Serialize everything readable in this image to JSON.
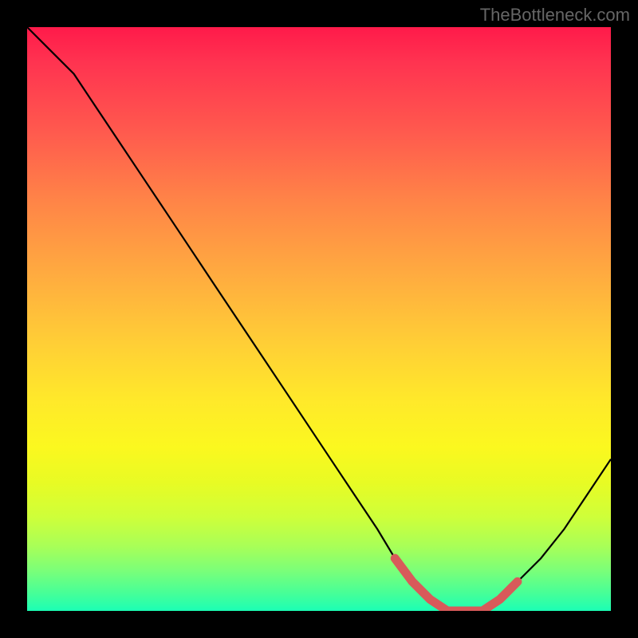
{
  "watermark": "TheBottleneck.com",
  "chart_data": {
    "type": "line",
    "title": "",
    "xlabel": "",
    "ylabel": "",
    "xlim": [
      0,
      100
    ],
    "ylim": [
      0,
      100
    ],
    "series": [
      {
        "name": "bottleneck-curve",
        "x": [
          0,
          4,
          8,
          12,
          16,
          20,
          24,
          28,
          32,
          36,
          40,
          44,
          48,
          52,
          56,
          60,
          63,
          66,
          69,
          72,
          75,
          78,
          81,
          84,
          88,
          92,
          96,
          100
        ],
        "values": [
          100,
          96,
          92,
          86,
          80,
          74,
          68,
          62,
          56,
          50,
          44,
          38,
          32,
          26,
          20,
          14,
          9,
          5,
          2,
          0,
          0,
          0,
          2,
          5,
          9,
          14,
          20,
          26
        ]
      },
      {
        "name": "optimum-highlight",
        "x": [
          63,
          66,
          69,
          72,
          75,
          78,
          81,
          84
        ],
        "values": [
          9,
          5,
          2,
          0,
          0,
          0,
          2,
          5
        ]
      }
    ],
    "gradient_stops": [
      {
        "pos": 0,
        "color": "#ff1a4a"
      },
      {
        "pos": 50,
        "color": "#ffce36"
      },
      {
        "pos": 100,
        "color": "#1bffb5"
      }
    ]
  }
}
